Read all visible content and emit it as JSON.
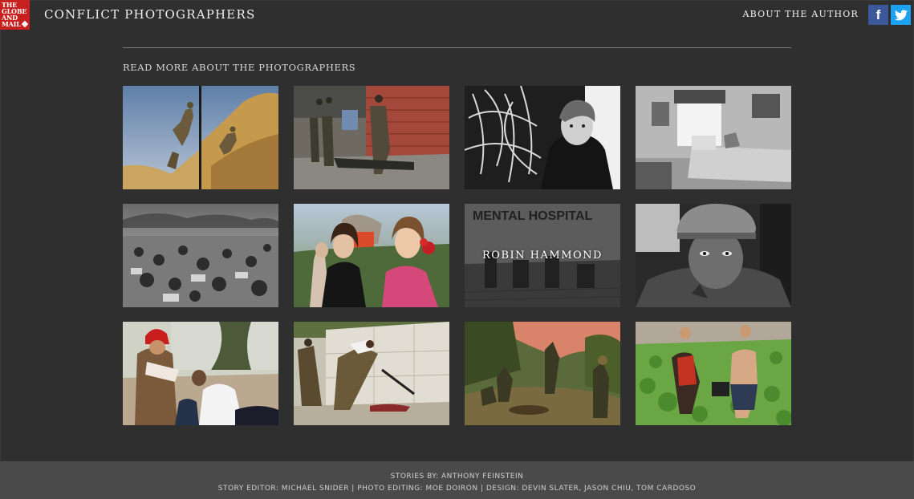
{
  "header": {
    "logo_lines": [
      "THE",
      "GLOBE",
      "AND",
      "MAIL"
    ],
    "site_title": "CONFLICT PHOTOGRAPHERS",
    "about_link": "ABOUT THE AUTHOR",
    "facebook_glyph": "f",
    "facebook_color": "#3b5998",
    "twitter_color": "#1da1f2",
    "brand_color": "#c81f1f"
  },
  "section_heading": "READ MORE ABOUT THE PHOTOGRAPHERS",
  "tiles": [
    {
      "name": "photo-soldiers-climbing-hill",
      "label": ""
    },
    {
      "name": "photo-soldiers-street-bodies",
      "label": ""
    },
    {
      "name": "photo-girl-chalkboard",
      "label": ""
    },
    {
      "name": "photo-bedroom",
      "label": ""
    },
    {
      "name": "photo-refugee-camp",
      "label": ""
    },
    {
      "name": "photo-women-smiling-flower",
      "label": ""
    },
    {
      "name": "photo-mental-hospital",
      "label": "ROBIN HAMMOND",
      "hovered": true
    },
    {
      "name": "photo-soldier-helmet-portrait",
      "label": ""
    },
    {
      "name": "photo-firefighter-child",
      "label": ""
    },
    {
      "name": "photo-soldier-wall-rifle",
      "label": ""
    },
    {
      "name": "photo-jungle-soldiers",
      "label": ""
    },
    {
      "name": "photo-men-running-field",
      "label": ""
    }
  ],
  "footer": {
    "line1": "STORIES BY: ANTHONY FEINSTEIN",
    "line2": "STORY EDITOR: MICHAEL SNIDER | PHOTO EDITING: MOE DOIRON | DESIGN: DEVIN SLATER, JASON CHIU, TOM CARDOSO"
  }
}
